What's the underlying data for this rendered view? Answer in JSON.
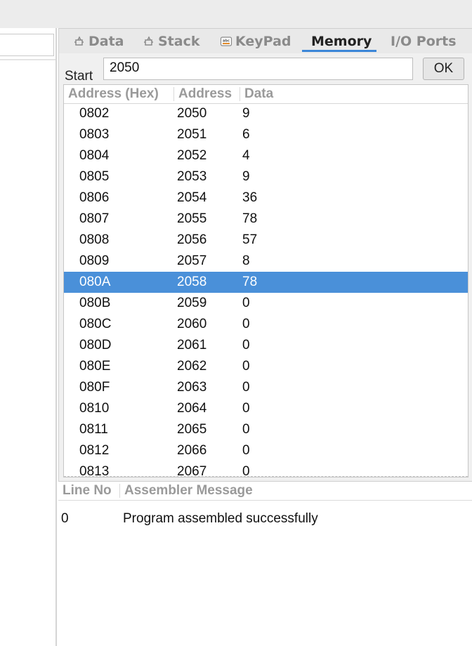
{
  "tabs": [
    {
      "label": "Data",
      "icon": "chip-icon",
      "active": false
    },
    {
      "label": "Stack",
      "icon": "chip-icon",
      "active": false
    },
    {
      "label": "KeyPad",
      "icon": "keypad-icon",
      "active": false
    },
    {
      "label": "Memory",
      "icon": "",
      "active": true
    },
    {
      "label": "I/O Ports",
      "icon": "",
      "active": false
    }
  ],
  "memory": {
    "start_label": "Start",
    "start_value": "2050",
    "ok_label": "OK",
    "columns": [
      "Address (Hex)",
      "Address",
      "Data"
    ],
    "selected_index": 8,
    "rows": [
      {
        "hex": "0802",
        "dec": "2050",
        "data": "9"
      },
      {
        "hex": "0803",
        "dec": "2051",
        "data": "6"
      },
      {
        "hex": "0804",
        "dec": "2052",
        "data": "4"
      },
      {
        "hex": "0805",
        "dec": "2053",
        "data": "9"
      },
      {
        "hex": "0806",
        "dec": "2054",
        "data": "36"
      },
      {
        "hex": "0807",
        "dec": "2055",
        "data": "78"
      },
      {
        "hex": "0808",
        "dec": "2056",
        "data": "57"
      },
      {
        "hex": "0809",
        "dec": "2057",
        "data": "8"
      },
      {
        "hex": "080A",
        "dec": "2058",
        "data": "78"
      },
      {
        "hex": "080B",
        "dec": "2059",
        "data": "0"
      },
      {
        "hex": "080C",
        "dec": "2060",
        "data": "0"
      },
      {
        "hex": "080D",
        "dec": "2061",
        "data": "0"
      },
      {
        "hex": "080E",
        "dec": "2062",
        "data": "0"
      },
      {
        "hex": "080F",
        "dec": "2063",
        "data": "0"
      },
      {
        "hex": "0810",
        "dec": "2064",
        "data": "0"
      },
      {
        "hex": "0811",
        "dec": "2065",
        "data": "0"
      },
      {
        "hex": "0812",
        "dec": "2066",
        "data": "0"
      },
      {
        "hex": "0813",
        "dec": "2067",
        "data": "0"
      }
    ]
  },
  "messages": {
    "columns": [
      "Line No",
      "Assembler Message"
    ],
    "rows": [
      {
        "line": "0",
        "message": "Program assembled successfully"
      }
    ]
  },
  "colors": {
    "selection": "#4a90d9",
    "tab_underline": "#3b86d8"
  }
}
